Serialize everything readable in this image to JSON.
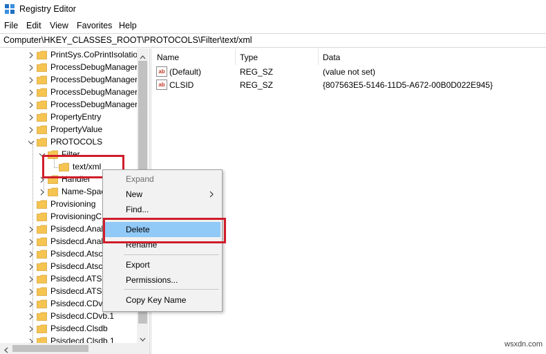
{
  "window": {
    "title": "Registry Editor"
  },
  "menu": [
    "File",
    "Edit",
    "View",
    "Favorites",
    "Help"
  ],
  "address": "Computer\\HKEY_CLASSES_ROOT\\PROTOCOLS\\Filter\\text/xml",
  "tree": {
    "items": [
      {
        "label": "PrintSys.CoPrintIsolatio"
      },
      {
        "label": "ProcessDebugManager"
      },
      {
        "label": "ProcessDebugManager"
      },
      {
        "label": "ProcessDebugManager"
      },
      {
        "label": "ProcessDebugManager"
      },
      {
        "label": "PropertyEntry"
      },
      {
        "label": "PropertyValue"
      },
      {
        "label": "PROTOCOLS"
      },
      {
        "label": "Filter"
      },
      {
        "label": "text/xml"
      },
      {
        "label": "Handler"
      },
      {
        "label": "Name-Spac"
      },
      {
        "label": "Provisioning"
      },
      {
        "label": "ProvisioningC"
      },
      {
        "label": "Psisdecd.Anal"
      },
      {
        "label": "Psisdecd.Anal"
      },
      {
        "label": "Psisdecd.Atscl"
      },
      {
        "label": "Psisdecd.Atscl"
      },
      {
        "label": "Psisdecd.ATSC"
      },
      {
        "label": "Psisdecd.ATSC"
      },
      {
        "label": "Psisdecd.CDvb"
      },
      {
        "label": "Psisdecd.CDvb.1"
      },
      {
        "label": "Psisdecd.Clsdb"
      },
      {
        "label": "Psisdecd.Clsdb.1"
      }
    ]
  },
  "list": {
    "columns": [
      "Name",
      "Type",
      "Data"
    ],
    "rows": [
      {
        "name": "(Default)",
        "type": "REG_SZ",
        "data": "(value not set)",
        "icon": "ab"
      },
      {
        "name": "CLSID",
        "type": "REG_SZ",
        "data": "{807563E5-5146-11D5-A672-00B0D022E945}",
        "icon": "ab"
      }
    ]
  },
  "context_menu": {
    "items": [
      {
        "label": "Expand",
        "disabled": true
      },
      {
        "label": "New",
        "submenu": true
      },
      {
        "label": "Find..."
      },
      {
        "label": "Delete",
        "highlighted": true
      },
      {
        "label": "Rename"
      },
      {
        "label": "Export"
      },
      {
        "label": "Permissions..."
      },
      {
        "label": "Copy Key Name"
      }
    ]
  },
  "watermark": "wsxdn.com",
  "colors": {
    "highlight_border": "#d01c2a",
    "menu_hover": "#91c9f7",
    "folder": "#f5c451"
  }
}
